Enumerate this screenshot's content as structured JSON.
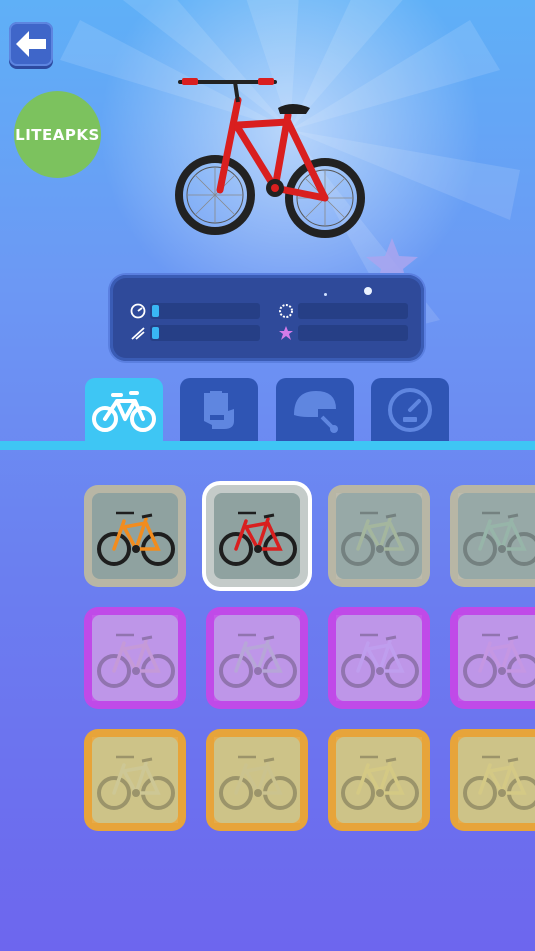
{
  "screen": {
    "brand_label": "LITEAPKS",
    "back_icon": "arrow-left-icon"
  },
  "preview": {
    "bike_color": "#d91f1f"
  },
  "stats": [
    {
      "name": "speed",
      "icon": "speedometer-icon",
      "level": 0.07
    },
    {
      "name": "grip",
      "icon": "tire-icon",
      "level": 0.0
    },
    {
      "name": "control",
      "icon": "handlebar-icon",
      "level": 0.07
    },
    {
      "name": "boost",
      "icon": "boost-icon",
      "level": 0.0
    }
  ],
  "tabs": [
    {
      "name": "bikes",
      "icon": "bike-icon",
      "active": true
    },
    {
      "name": "gloves",
      "icon": "glove-icon",
      "active": false
    },
    {
      "name": "helmets",
      "icon": "helmet-icon",
      "active": false
    },
    {
      "name": "speedometer",
      "icon": "speedometer-icon",
      "active": false
    }
  ],
  "bikes": [
    {
      "tier": "gray",
      "color": "#f28c1e",
      "owned": true,
      "selected": false
    },
    {
      "tier": "gray",
      "color": "#d91f1f",
      "owned": true,
      "selected": true
    },
    {
      "tier": "gray",
      "color": "#c8d88a",
      "owned": false,
      "selected": false
    },
    {
      "tier": "gray",
      "color": "#9ad7b0",
      "owned": false,
      "selected": false
    },
    {
      "tier": "purple",
      "color": "#d9a6b0",
      "owned": false,
      "selected": false
    },
    {
      "tier": "purple",
      "color": "#a8d2b0",
      "owned": false,
      "selected": false
    },
    {
      "tier": "purple",
      "color": "#c5b3ff",
      "owned": false,
      "selected": false
    },
    {
      "tier": "purple",
      "color": "#d79ad8",
      "owned": false,
      "selected": false
    },
    {
      "tier": "gold",
      "color": "#cfd3b8",
      "owned": false,
      "selected": false
    },
    {
      "tier": "gold",
      "color": "#c7c3a0",
      "owned": false,
      "selected": false
    },
    {
      "tier": "gold",
      "color": "#e8d97a",
      "owned": false,
      "selected": false
    },
    {
      "tier": "gold",
      "color": "#e9d980",
      "owned": false,
      "selected": false
    }
  ],
  "colors": {
    "accent": "#3ec6f4",
    "tab_inactive": "#2f55b4",
    "panel": "#2f4a9a",
    "stat_fill": "#39b6f4"
  }
}
